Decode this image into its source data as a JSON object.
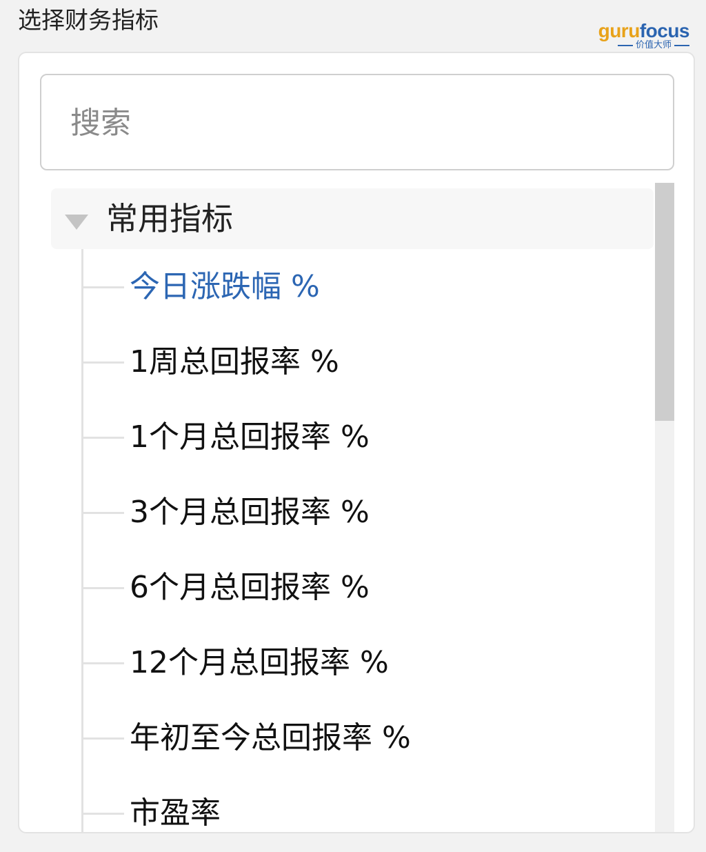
{
  "header": {
    "title": "选择财务指标",
    "logo": {
      "guru": "guru",
      "focus": "focus",
      "tagline": "价值大师",
      "colors": {
        "guru": "#e8a21a",
        "focus": "#2b64b0"
      }
    }
  },
  "search": {
    "placeholder": "搜索",
    "value": ""
  },
  "tree": {
    "group_label": "常用指标",
    "group_icon": "caret-down-icon",
    "items": [
      {
        "label": "今日涨跌幅 %",
        "active": true
      },
      {
        "label": "1周总回报率 %"
      },
      {
        "label": "1个月总回报率 %"
      },
      {
        "label": "3个月总回报率 %"
      },
      {
        "label": "6个月总回报率 %"
      },
      {
        "label": "12个月总回报率 %"
      },
      {
        "label": "年初至今总回报率 %"
      },
      {
        "label": "市盈率"
      }
    ]
  },
  "colors": {
    "active_item": "#2c66b3",
    "text": "#111111"
  }
}
